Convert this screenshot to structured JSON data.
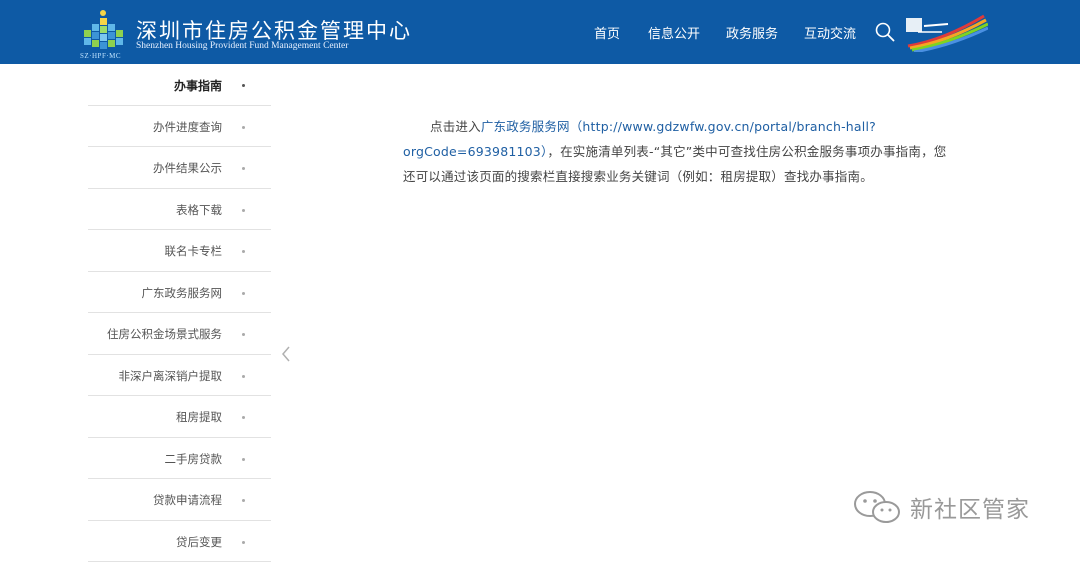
{
  "header": {
    "title_cn": "深圳市住房公积金管理中心",
    "title_en": "Shenzhen Housing Provident Fund Management Center",
    "logo_sub": "SZ·HPF·MC",
    "nav": [
      "首页",
      "信息公开",
      "政务服务",
      "互动交流"
    ],
    "brand_color": "#0e5aa5"
  },
  "sidebar": {
    "items": [
      {
        "label": "办事指南",
        "active": true
      },
      {
        "label": "办件进度查询"
      },
      {
        "label": "办件结果公示"
      },
      {
        "label": "表格下载"
      },
      {
        "label": "联名卡专栏"
      },
      {
        "label": "广东政务服务网"
      },
      {
        "label": "住房公积金场景式服务"
      },
      {
        "label": "非深户离深销户提取"
      },
      {
        "label": "租房提取"
      },
      {
        "label": "二手房贷款"
      },
      {
        "label": "贷款申请流程"
      },
      {
        "label": "贷后变更"
      }
    ]
  },
  "content": {
    "prefix": "点击进入",
    "link": "广东政务服务网（http://www.gdzwfw.gov.cn/portal/branch-hall?orgCode=693981103）",
    "suffix": "，在实施清单列表-“其它”类中可查找住房公积金服务事项办事指南，您还可以通过该页面的搜索栏直接搜索业务关键词（例如：租房提取）查找办事指南。",
    "link_color": "#1f5fa3"
  },
  "watermark": {
    "text": "新社区管家"
  }
}
